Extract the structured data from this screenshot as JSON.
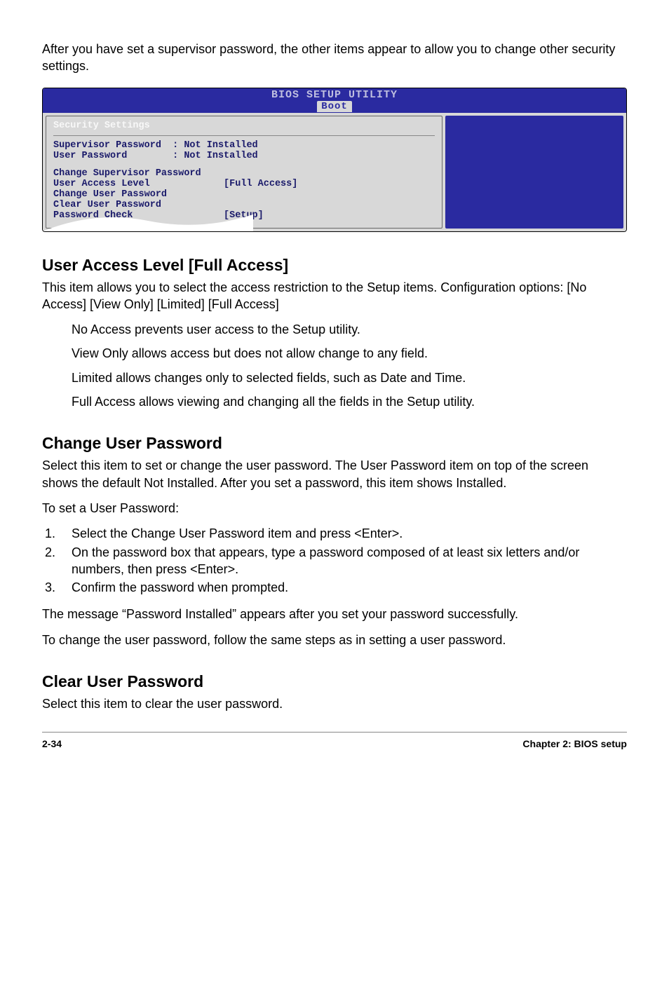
{
  "intro": "After you have set a supervisor password, the other items appear to allow you to change other security settings.",
  "bios": {
    "title": "BIOS SETUP UTILITY",
    "tab": "Boot",
    "section_title": "Security Settings",
    "sup_pass_label": "Supervisor Password  : Not Installed",
    "user_pass_label": "User Password        : Not Installed",
    "change_sup": "Change Supervisor Password",
    "user_access": "User Access Level             [Full Access]",
    "change_user": "Change User Password",
    "clear_user": "Clear User Password",
    "pass_check": "Password Check                [Setup]"
  },
  "ual": {
    "heading": "User Access Level [Full Access]",
    "p1": "This item allows you to select the access restriction to the Setup items. Configuration options: [No Access] [View Only] [Limited] [Full Access]",
    "no_access": "No Access prevents user access to the Setup utility.",
    "view_only": "View Only allows access but does not allow change to any field.",
    "limited": "Limited allows changes only to selected fields, such as Date and Time.",
    "full_access": "Full Access allows viewing and changing all the fields in the Setup utility."
  },
  "cup": {
    "heading": "Change User Password",
    "p1": "Select this item to set or change the user password. The User Password item on top of the screen shows the default Not Installed. After you set a password, this item shows Installed.",
    "p2": "To set a User Password:",
    "step1": "Select the Change User Password item and press <Enter>.",
    "step2": "On the password box that appears, type a password composed of at least six letters and/or numbers, then press <Enter>.",
    "step3": "Confirm the password when prompted.",
    "p3": "The message “Password Installed” appears after you set your password successfully.",
    "p4": "To change the user password, follow the same steps as in setting a user password."
  },
  "clup": {
    "heading": "Clear User Password",
    "p1": "Select this item to clear the user password."
  },
  "footer": {
    "left": "2-34",
    "right": "Chapter 2: BIOS setup"
  }
}
